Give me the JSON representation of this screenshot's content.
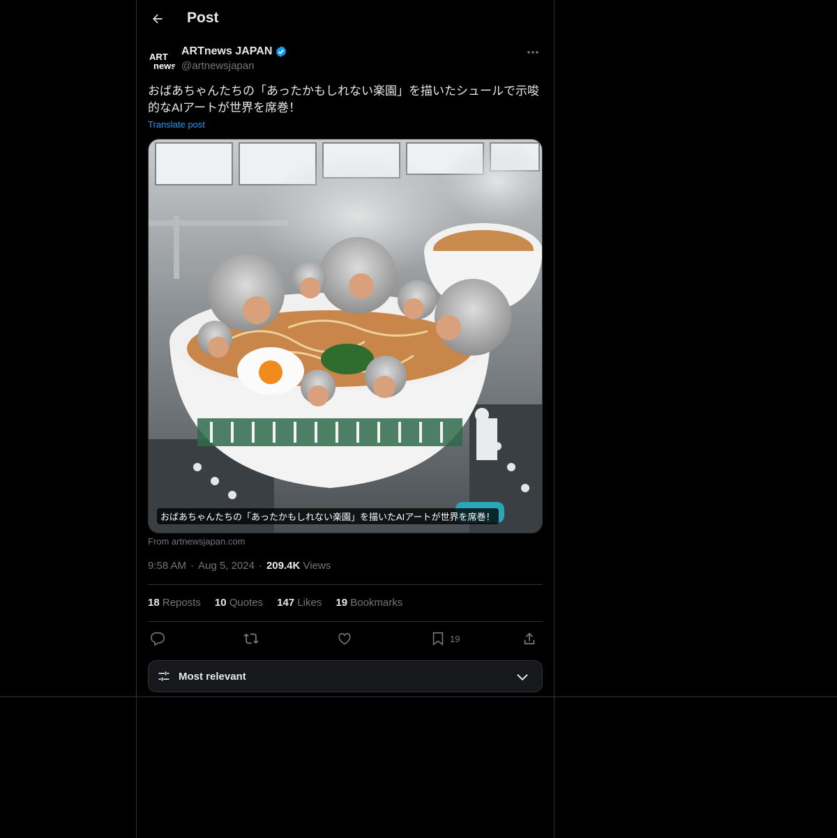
{
  "header": {
    "title": "Post"
  },
  "author": {
    "name": "ARTnews JAPAN",
    "handle": "@artnewsjapan",
    "avatar_text_top": "ART",
    "avatar_text_bottom": "news"
  },
  "post": {
    "text": "おばあちゃんたちの「あったかもしれない楽園」を描いたシュールで示唆的なAIアートが世界を席巻！",
    "translate_label": "Translate post",
    "media_caption": "おばあちゃんたちの「あったかもしれない楽園」を描いたAIアートが世界を席巻！",
    "source": "From artnewsjapan.com",
    "time": "9:58 AM",
    "date": "Aug 5, 2024",
    "views_count": "209.4K",
    "views_label": "Views",
    "dot": "·"
  },
  "stats": [
    {
      "count": "18",
      "label": "Reposts"
    },
    {
      "count": "10",
      "label": "Quotes"
    },
    {
      "count": "147",
      "label": "Likes"
    },
    {
      "count": "19",
      "label": "Bookmarks"
    }
  ],
  "actions": {
    "reply": {
      "icon": "reply-icon",
      "count": ""
    },
    "repost": {
      "icon": "repost-icon",
      "count": ""
    },
    "like": {
      "icon": "heart-icon",
      "count": ""
    },
    "bookmark": {
      "icon": "bookmark-icon",
      "count": "19"
    },
    "share": {
      "icon": "share-icon",
      "count": ""
    }
  },
  "sort": {
    "label": "Most relevant"
  },
  "colors": {
    "accent": "#1d9bf0",
    "muted": "#71767b",
    "text": "#e7e9ea",
    "border": "#2f3336"
  }
}
